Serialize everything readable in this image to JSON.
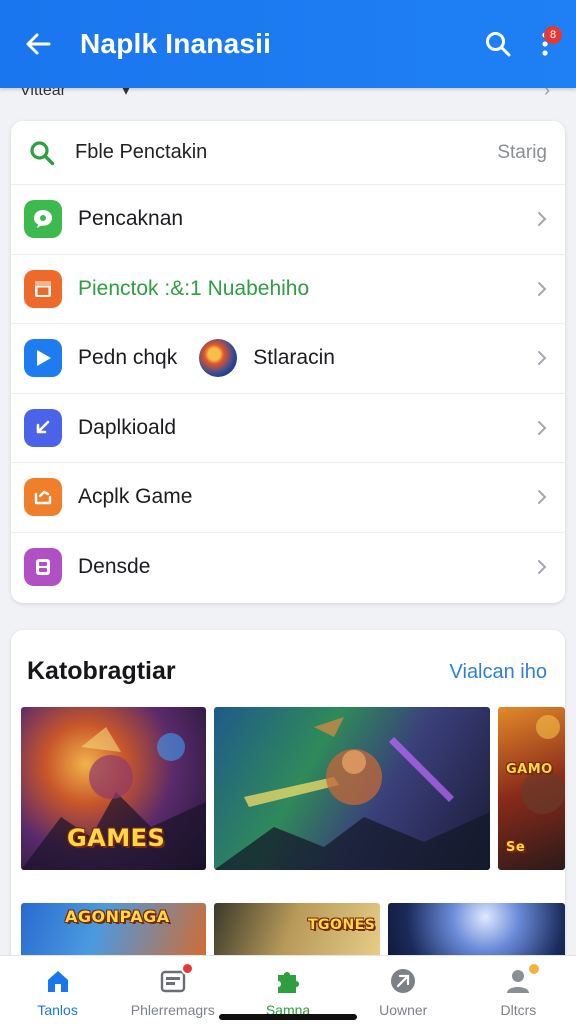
{
  "header": {
    "title": "Naplk Inanasii",
    "badge": "8",
    "back_icon": "arrow-left-icon",
    "search_icon": "search-icon",
    "more_icon": "more-vertical-icon",
    "color": "#1a76ee"
  },
  "cut_row": {
    "text": "Vittear"
  },
  "search": {
    "placeholder": "Fble Penctakin",
    "action": "Starig",
    "icon_color": "#2e9e3f"
  },
  "menu": {
    "items": [
      {
        "label": "Pencaknan",
        "icon": "chat-bubble-icon",
        "color": "#3dba4e"
      },
      {
        "label": "Pienctok :&:1 Nuabehiho",
        "icon": "box-icon",
        "color": "#ee6a2b",
        "highlight": true
      },
      {
        "label": "Pedn chqk",
        "extra": "Stlaracin",
        "icon": "play-icon",
        "color": "#1f7cf0"
      },
      {
        "label": "Daplkioald",
        "icon": "download-icon",
        "color": "#4b63e8"
      },
      {
        "label": "Acplk Game",
        "icon": "game-icon",
        "color": "#f07f2c"
      },
      {
        "label": "Densde",
        "icon": "device-icon",
        "color": "#b14fc5"
      }
    ]
  },
  "games": {
    "title": "Katobragtiar",
    "link": "Vialcan iho",
    "tiles": [
      {
        "label": "GAMES"
      },
      {
        "label": ""
      },
      {
        "label": "GAMO Se"
      },
      {
        "label": "AGONPAGA"
      },
      {
        "label": "TGONES"
      },
      {
        "label": ""
      }
    ]
  },
  "nav": {
    "items": [
      {
        "label": "Tanlos",
        "icon": "home-icon",
        "active": "blue"
      },
      {
        "label": "Phlerremagrs",
        "icon": "inbox-icon",
        "badge": true
      },
      {
        "label": "Samna",
        "icon": "puzzle-icon",
        "active": "green"
      },
      {
        "label": "Uowner",
        "icon": "shield-icon"
      },
      {
        "label": "Dltcrs",
        "icon": "person-icon",
        "dot": true
      }
    ]
  }
}
